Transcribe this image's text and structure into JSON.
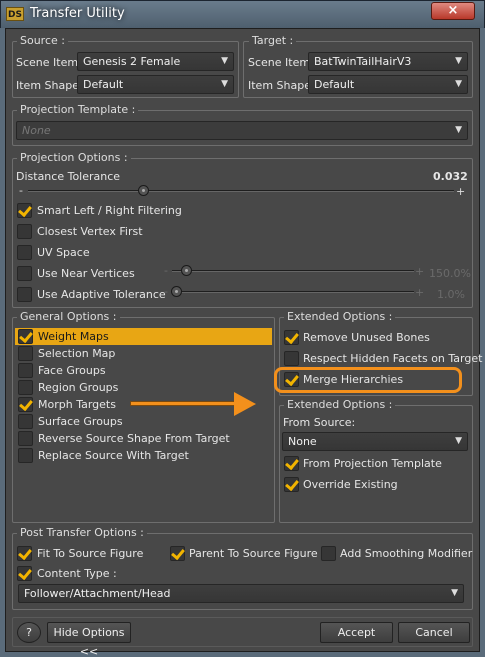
{
  "window": {
    "title": "Transfer Utility",
    "app_icon_text": "DS",
    "close_symbol": "×"
  },
  "source": {
    "group_label": "Source :",
    "scene_item_label": "Scene Item :",
    "scene_item_value": "Genesis 2 Female",
    "item_shape_label": "Item Shape :",
    "item_shape_value": "Default"
  },
  "target": {
    "group_label": "Target :",
    "scene_item_label": "Scene Item :",
    "scene_item_value": "BatTwinTailHairV3",
    "item_shape_label": "Item Shape :",
    "item_shape_value": "Default"
  },
  "projection_template": {
    "group_label": "Projection Template :",
    "value": "None"
  },
  "projection_options": {
    "group_label": "Projection Options :",
    "distance_tolerance_label": "Distance Tolerance",
    "distance_tolerance_value": "0.032",
    "minus": "-",
    "plus": "+",
    "smart_filtering": {
      "label": "Smart Left / Right Filtering",
      "checked": true
    },
    "closest_vertex": {
      "label": "Closest Vertex First",
      "checked": false
    },
    "uv_space": {
      "label": "UV Space",
      "checked": false
    },
    "near_vertices": {
      "label": "Use Near Vertices",
      "checked": false,
      "value": "150.0%"
    },
    "adaptive_tolerance": {
      "label": "Use Adaptive Tolerance",
      "checked": false,
      "value": "1.0%"
    }
  },
  "general_options": {
    "group_label": "General Options :",
    "items": [
      {
        "label": "Weight Maps",
        "checked": true,
        "selected": true
      },
      {
        "label": "Selection Map",
        "checked": false
      },
      {
        "label": "Face Groups",
        "checked": false
      },
      {
        "label": "Region Groups",
        "checked": false
      },
      {
        "label": "Morph Targets",
        "checked": true
      },
      {
        "label": "Surface Groups",
        "checked": false
      },
      {
        "label": "Reverse Source Shape From Target",
        "checked": false
      },
      {
        "label": "Replace Source With Target",
        "checked": false
      }
    ]
  },
  "extended_options_1": {
    "group_label": "Extended Options :",
    "remove_unused_bones": {
      "label": "Remove Unused Bones",
      "checked": true
    },
    "respect_hidden_facets": {
      "label": "Respect Hidden Facets on Target",
      "checked": false
    },
    "merge_hierarchies": {
      "label": "Merge Hierarchies",
      "checked": true
    }
  },
  "extended_options_2": {
    "group_label": "Extended Options :",
    "from_source_label": "From Source:",
    "from_source_value": "None",
    "from_projection_template": {
      "label": "From Projection Template",
      "checked": true
    },
    "override_existing": {
      "label": "Override Existing",
      "checked": true
    }
  },
  "post_transfer": {
    "group_label": "Post Transfer Options :",
    "fit_to_source": {
      "label": "Fit To Source Figure",
      "checked": true
    },
    "parent_to_source": {
      "label": "Parent To Source Figure",
      "checked": true
    },
    "add_smoothing": {
      "label": "Add Smoothing Modifier",
      "checked": false
    },
    "content_type": {
      "label": "Content Type :",
      "checked": true
    },
    "content_type_value": "Follower/Attachment/Head"
  },
  "buttons": {
    "help": "?",
    "hide_options": "Hide Options <<",
    "accept": "Accept",
    "cancel": "Cancel"
  },
  "colors": {
    "accent": "#f3901c",
    "check": "#f2b400",
    "selection": "#e8a614",
    "title_bar": "#5a6b7a",
    "close": "#c8453a"
  }
}
